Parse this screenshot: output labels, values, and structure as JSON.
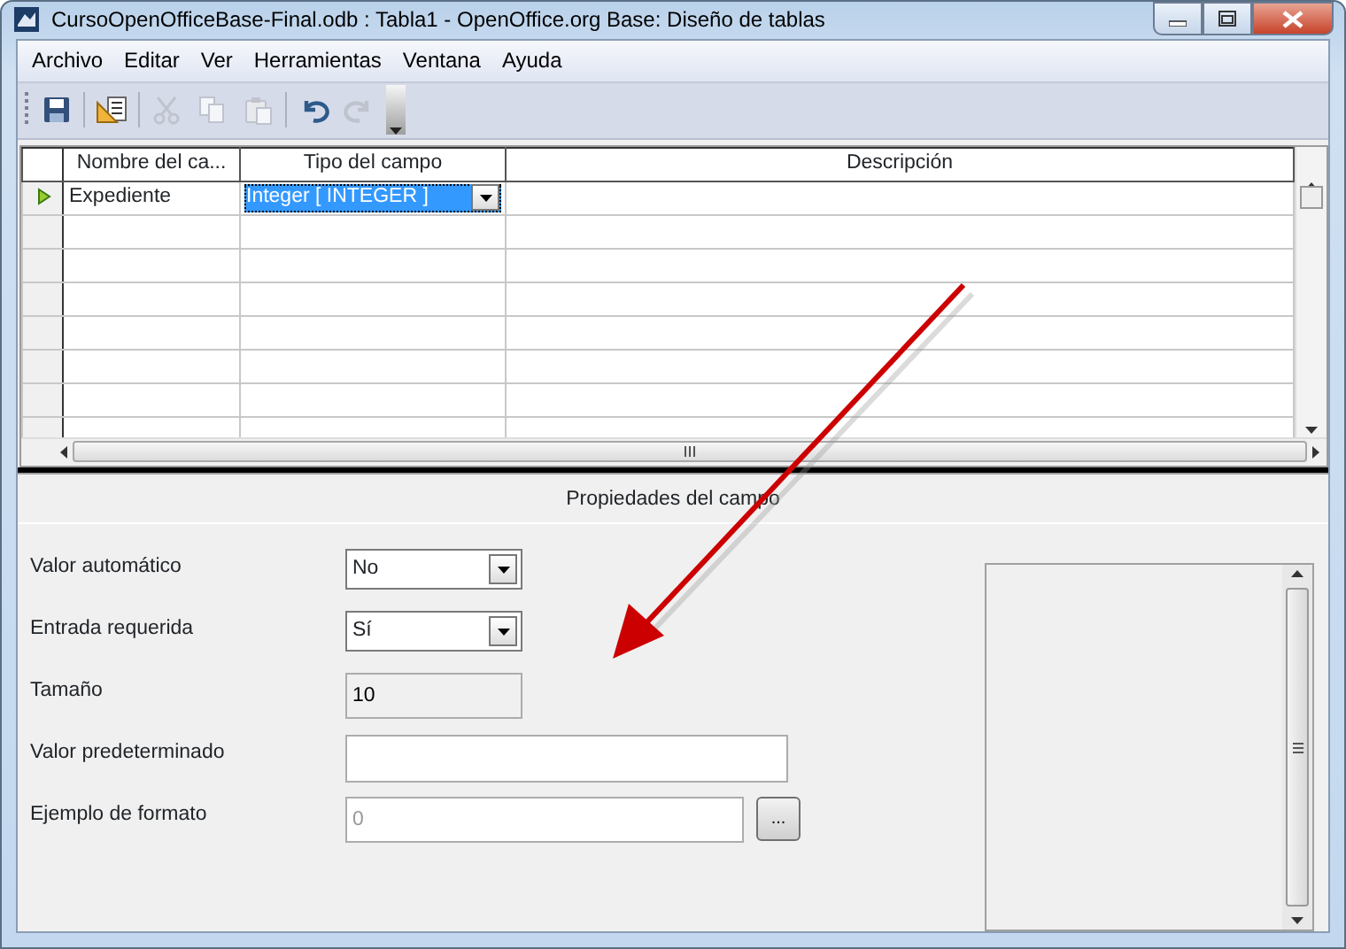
{
  "window": {
    "title": "CursoOpenOfficeBase-Final.odb : Tabla1 - OpenOffice.org Base: Diseño de tablas"
  },
  "menu": [
    "Archivo",
    "Editar",
    "Ver",
    "Herramientas",
    "Ventana",
    "Ayuda"
  ],
  "toolbar": [
    {
      "kind": "save",
      "disabled": false
    },
    {
      "kind": "sep"
    },
    {
      "kind": "design",
      "disabled": false
    },
    {
      "kind": "sep"
    },
    {
      "kind": "cut",
      "disabled": true
    },
    {
      "kind": "copy",
      "disabled": true
    },
    {
      "kind": "paste",
      "disabled": true
    },
    {
      "kind": "sep"
    },
    {
      "kind": "undo",
      "disabled": false
    },
    {
      "kind": "redo",
      "disabled": true
    }
  ],
  "table": {
    "columns": [
      "Nombre del ca...",
      "Tipo del campo",
      "Descripción"
    ],
    "rows": [
      {
        "current": true,
        "name": "Expediente",
        "type": "Integer [ INTEGER ]",
        "type_selected": true
      },
      {
        "current": false
      },
      {
        "current": false
      },
      {
        "current": false
      },
      {
        "current": false
      },
      {
        "current": false
      },
      {
        "current": false
      },
      {
        "current": false
      }
    ]
  },
  "properties": {
    "title": "Propiedades del campo",
    "fields": [
      {
        "label": "Valor automático",
        "kind": "dropdown",
        "value": "No"
      },
      {
        "label": "Entrada requerida",
        "kind": "dropdown",
        "value": "Sí"
      },
      {
        "label": "Tamaño",
        "kind": "readonly",
        "value": "10"
      },
      {
        "label": "Valor predeterminado",
        "kind": "text"
      },
      {
        "label": "Ejemplo de formato",
        "kind": "text-button",
        "value": "0",
        "disabled": true,
        "button": "..."
      }
    ]
  },
  "annotation": {
    "kind": "arrow"
  }
}
